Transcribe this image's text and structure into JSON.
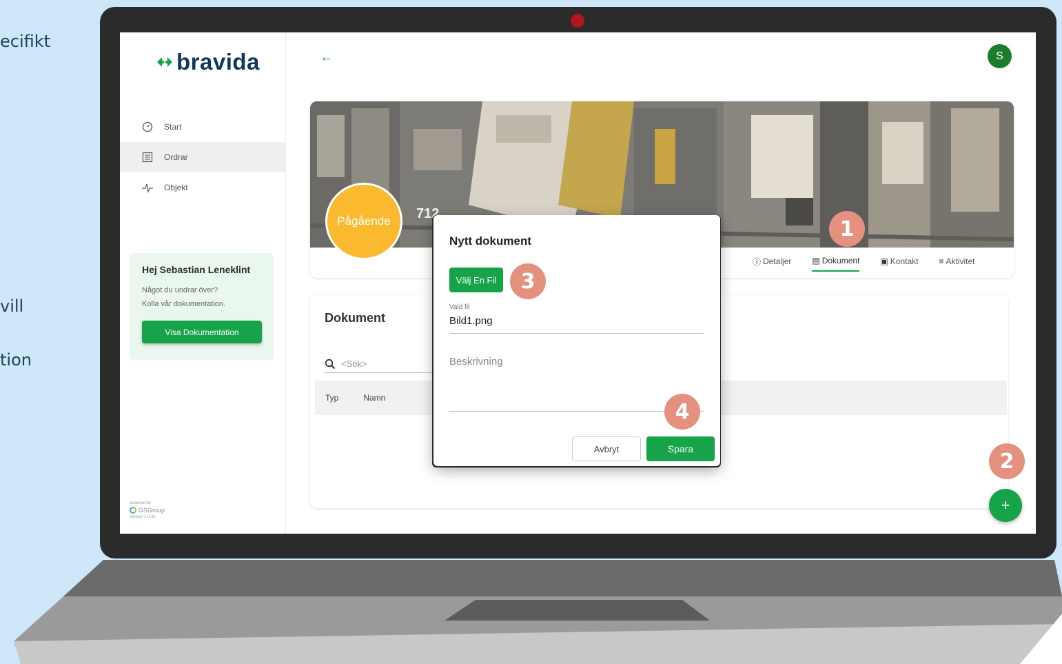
{
  "side_text": [
    "ecifikt",
    "vill",
    "tion"
  ],
  "sidebar": {
    "logo_text": "bravida",
    "items": [
      {
        "label": "Start",
        "icon": "speedometer-icon"
      },
      {
        "label": "Ordrar",
        "icon": "list-icon"
      },
      {
        "label": "Objekt",
        "icon": "pulse-icon"
      }
    ],
    "active_item": "Ordrar",
    "help": {
      "title": "Hej Sebastian Leneklint",
      "line1": "Något du undrar över?",
      "line2": "Kolla vår dokumentation.",
      "button": "Visa Dokumentation"
    },
    "powered": {
      "label": "powered by",
      "brand": "GSGroup",
      "version": "version 1.0.41"
    }
  },
  "header": {
    "avatar_initial": "S"
  },
  "hero": {
    "status": "Pågående",
    "order_number": "712",
    "tabs": [
      {
        "label": "Detaljer",
        "icon": "info-icon"
      },
      {
        "label": "Dokument",
        "icon": "document-icon"
      },
      {
        "label": "Kontakt",
        "icon": "contact-card-icon"
      },
      {
        "label": "Aktivitet",
        "icon": "list-lines-icon"
      }
    ],
    "active_tab": "Dokument"
  },
  "documents": {
    "title": "Dokument",
    "search_placeholder": "<Sök>",
    "columns": [
      "Typ",
      "Namn"
    ]
  },
  "modal": {
    "title": "Nytt dokument",
    "choose_button": "Välj En Fil",
    "file_label": "Vald fil",
    "file_value": "Bild1.png",
    "description_placeholder": "Beskrivning",
    "cancel": "Avbryt",
    "save": "Spara"
  },
  "fab": {
    "symbol": "+"
  },
  "markers": [
    "1",
    "2",
    "3",
    "4"
  ],
  "colors": {
    "accent": "#16a34a",
    "status": "#fbb92f",
    "marker": "#e5917f",
    "brand_navy": "#11365c"
  }
}
